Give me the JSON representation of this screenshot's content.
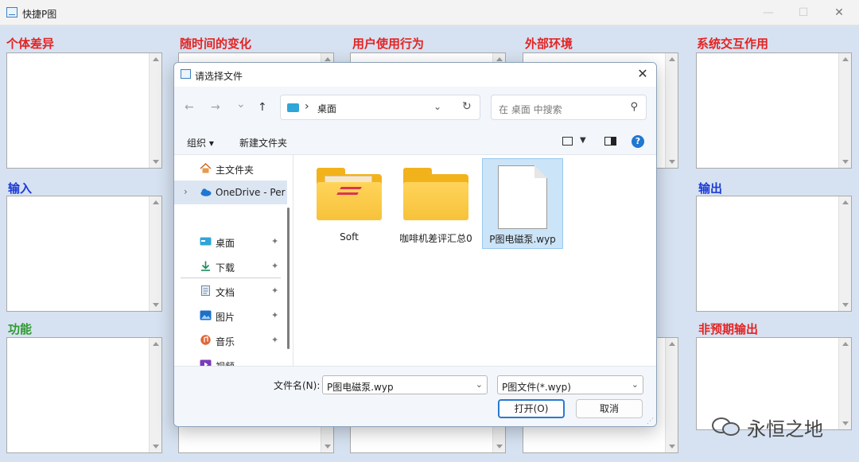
{
  "window": {
    "title": "快捷P图",
    "minimize": "—",
    "maximize": "☐",
    "close": "✕"
  },
  "panels": {
    "individual": "个体差异",
    "over_time": "随时间的变化",
    "user_behavior": "用户使用行为",
    "environment": "外部环境",
    "system_interaction": "系统交互作用",
    "input": "输入",
    "output": "输出",
    "function": "功能",
    "unexpected_output": "非预期输出"
  },
  "dialog": {
    "title": "请选择文件",
    "close": "✕",
    "nav": {
      "back": "←",
      "forward": "→",
      "recent": "⌄",
      "up": "↑"
    },
    "address": {
      "separator": "›",
      "path": "桌面",
      "dropdown": "⌄",
      "refresh": "↻"
    },
    "search_placeholder": "在 桌面 中搜索",
    "search_icon": "⚲",
    "toolbar": {
      "organize": "组织 ▾",
      "new_folder": "新建文件夹",
      "view_dropdown": "▼",
      "help": "?"
    },
    "sidebar": [
      {
        "label": "主文件夹",
        "icon": "home-icon"
      },
      {
        "label": "OneDrive - Per",
        "icon": "cloud-icon",
        "caret": "›"
      },
      {
        "label": "桌面",
        "icon": "desktop-icon",
        "pin": "✦"
      },
      {
        "label": "下载",
        "icon": "download-icon",
        "pin": "✦"
      },
      {
        "label": "文档",
        "icon": "document-icon",
        "pin": "✦"
      },
      {
        "label": "图片",
        "icon": "picture-icon",
        "pin": "✦"
      },
      {
        "label": "音乐",
        "icon": "music-icon",
        "pin": "✦"
      },
      {
        "label": "视频",
        "icon": "video-icon"
      }
    ],
    "files": [
      {
        "label": "Soft",
        "type": "folder-with-content"
      },
      {
        "label": "咖啡机差评汇总0",
        "type": "folder"
      },
      {
        "label": "P图电磁泵.wyp",
        "type": "file",
        "selected": true
      }
    ],
    "filename_label": "文件名(N):",
    "filename_value": "P图电磁泵.wyp",
    "filename_dropdown": "⌄",
    "filetype_value": "P图文件(*.wyp)",
    "filetype_dropdown": "⌄",
    "open_button": "打开(O)",
    "cancel_button": "取消",
    "resize_grip": "⋰"
  },
  "watermark": {
    "text": "永恒之地"
  },
  "colors": {
    "label_red": "#e42323",
    "label_blue": "#1d3ad6",
    "label_green": "#2f9a2f",
    "content_bg": "#d6e2f1",
    "accent": "#2b79d0"
  }
}
